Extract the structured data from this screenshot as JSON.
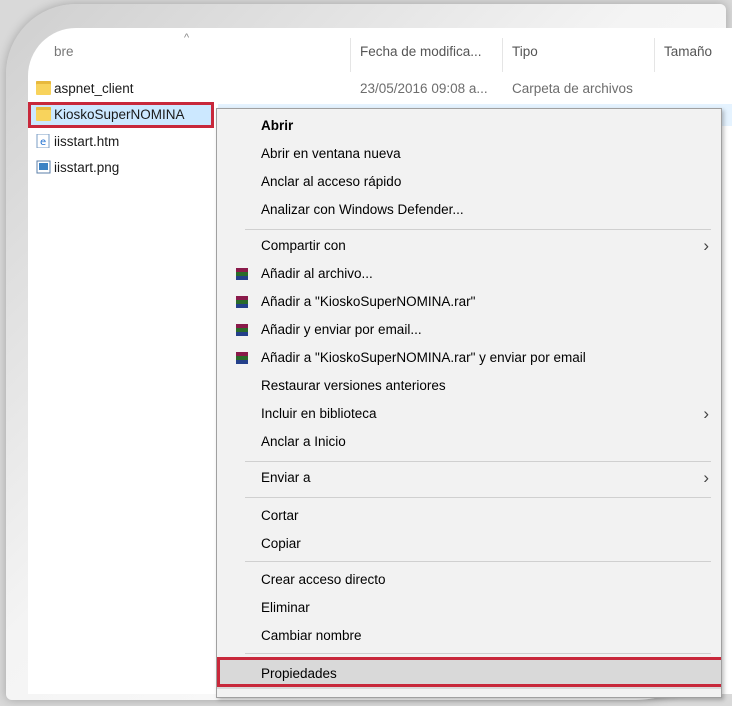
{
  "header": {
    "name_col": "bre",
    "date_col": "Fecha de modifica...",
    "type_col": "Tipo",
    "size_col": "Tamaño"
  },
  "files": [
    {
      "name": "aspnet_client",
      "date": "23/05/2016 09:08 a...",
      "type": "Carpeta de archivos",
      "icon": "folder-icon"
    },
    {
      "name": "KioskoSuperNOMINA",
      "date": "",
      "type": "",
      "icon": "folder-icon"
    },
    {
      "name": "iisstart.htm",
      "date": "",
      "type": "",
      "icon": "html-file-icon"
    },
    {
      "name": "iisstart.png",
      "date": "",
      "type": "",
      "icon": "image-file-icon"
    }
  ],
  "context_menu": {
    "open": "Abrir",
    "open_new_window": "Abrir en ventana nueva",
    "pin_quick_access": "Anclar al acceso rápido",
    "scan_defender": "Analizar con Windows Defender...",
    "share_with": "Compartir con",
    "add_archive": "Añadir al archivo...",
    "add_to_rar": "Añadir a \"KioskoSuperNOMINA.rar\"",
    "add_email": "Añadir y enviar por email...",
    "add_rar_email": "Añadir a \"KioskoSuperNOMINA.rar\" y enviar por email",
    "restore_versions": "Restaurar versiones anteriores",
    "include_library": "Incluir en biblioteca",
    "pin_start": "Anclar a Inicio",
    "send_to": "Enviar a",
    "cut": "Cortar",
    "copy": "Copiar",
    "create_shortcut": "Crear acceso directo",
    "delete": "Eliminar",
    "rename": "Cambiar nombre",
    "properties": "Propiedades"
  },
  "colors": {
    "highlight_border": "#c8283b",
    "selection": "#cce8ff",
    "menu_bg": "#f2f2f2"
  }
}
